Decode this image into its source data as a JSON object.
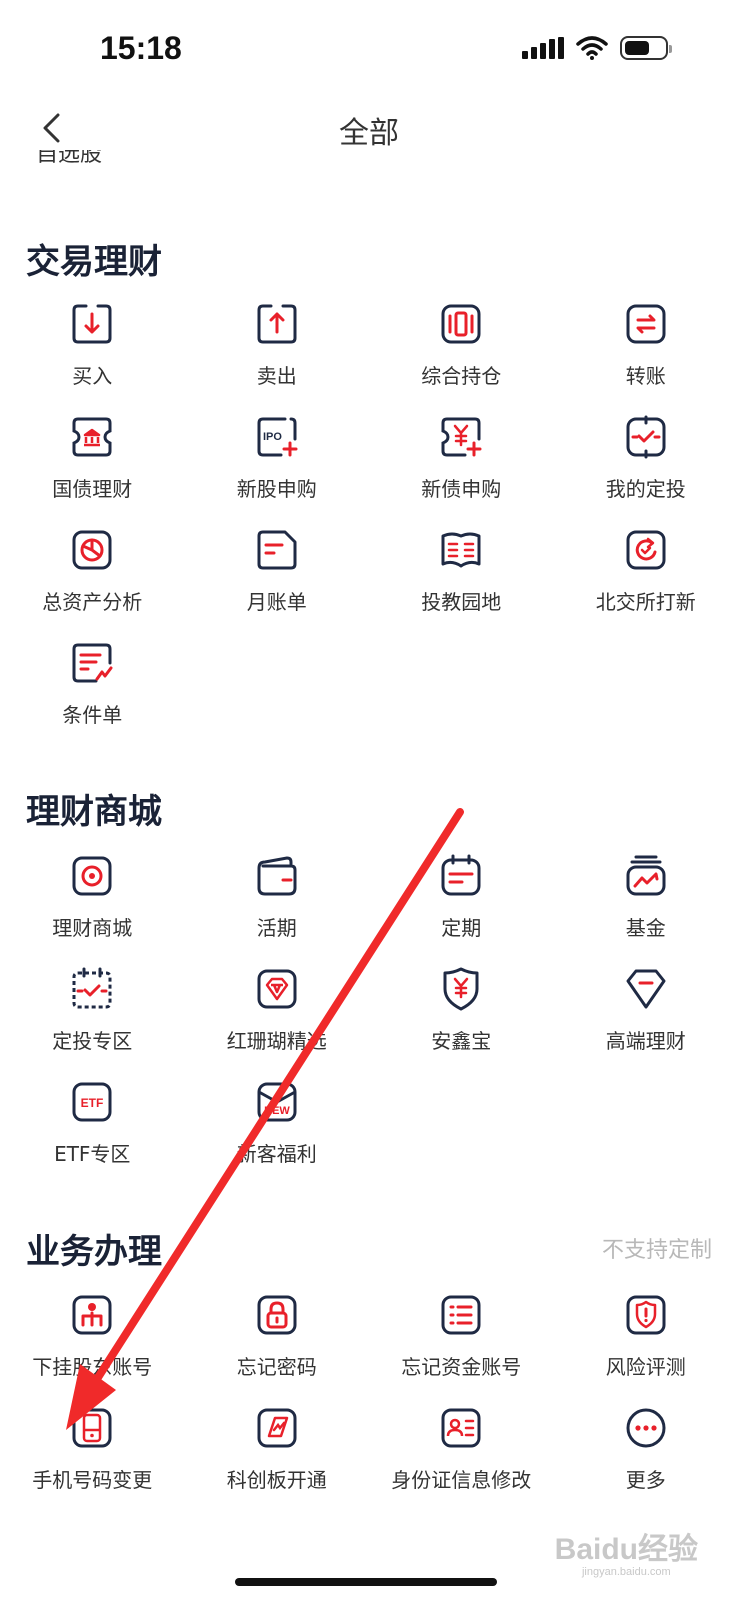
{
  "status_bar": {
    "time": "15:18"
  },
  "header": {
    "title": "全部",
    "partial_text": "自选股"
  },
  "sections": [
    {
      "title": "交易理财",
      "items": [
        {
          "label": "买入",
          "icon": "buy-icon"
        },
        {
          "label": "卖出",
          "icon": "sell-icon"
        },
        {
          "label": "综合持仓",
          "icon": "holdings-icon"
        },
        {
          "label": "转账",
          "icon": "transfer-icon"
        },
        {
          "label": "国债理财",
          "icon": "bond-icon"
        },
        {
          "label": "新股申购",
          "icon": "ipo-icon"
        },
        {
          "label": "新债申购",
          "icon": "new-bond-icon"
        },
        {
          "label": "我的定投",
          "icon": "fixed-invest-icon"
        },
        {
          "label": "总资产分析",
          "icon": "asset-analysis-icon"
        },
        {
          "label": "月账单",
          "icon": "monthly-bill-icon"
        },
        {
          "label": "投教园地",
          "icon": "education-icon"
        },
        {
          "label": "北交所打新",
          "icon": "bse-ipo-icon"
        },
        {
          "label": "条件单",
          "icon": "conditional-order-icon"
        }
      ]
    },
    {
      "title": "理财商城",
      "items": [
        {
          "label": "理财商城",
          "icon": "mall-icon"
        },
        {
          "label": "活期",
          "icon": "wallet-icon"
        },
        {
          "label": "定期",
          "icon": "calendar-icon"
        },
        {
          "label": "基金",
          "icon": "fund-icon"
        },
        {
          "label": "定投专区",
          "icon": "calendar-check-icon"
        },
        {
          "label": "红珊瑚精选",
          "icon": "gem-icon"
        },
        {
          "label": "安鑫宝",
          "icon": "shield-yuan-icon"
        },
        {
          "label": "高端理财",
          "icon": "diamond-icon"
        },
        {
          "label": "ETF专区",
          "icon": "etf-icon",
          "badge": "ETF"
        },
        {
          "label": "新客福利",
          "icon": "new-customer-icon",
          "badge": "NEW"
        }
      ]
    },
    {
      "title": "业务办理",
      "note": "不支持定制",
      "items": [
        {
          "label": "下挂股东账号",
          "icon": "shareholder-icon"
        },
        {
          "label": "忘记密码",
          "icon": "lock-icon"
        },
        {
          "label": "忘记资金账号",
          "icon": "list-icon"
        },
        {
          "label": "风险评测",
          "icon": "risk-shield-icon"
        },
        {
          "label": "手机号码变更",
          "icon": "phone-icon"
        },
        {
          "label": "科创板开通",
          "icon": "star-board-icon"
        },
        {
          "label": "身份证信息修改",
          "icon": "id-card-icon"
        },
        {
          "label": "更多",
          "icon": "more-icon"
        }
      ]
    }
  ],
  "watermark": {
    "main": "Baidu经验",
    "sub": "jingyan.baidu.com"
  },
  "colors": {
    "accent": "#e8202a",
    "icon_stroke": "#1f2a44",
    "arrow": "#f02a2a"
  }
}
